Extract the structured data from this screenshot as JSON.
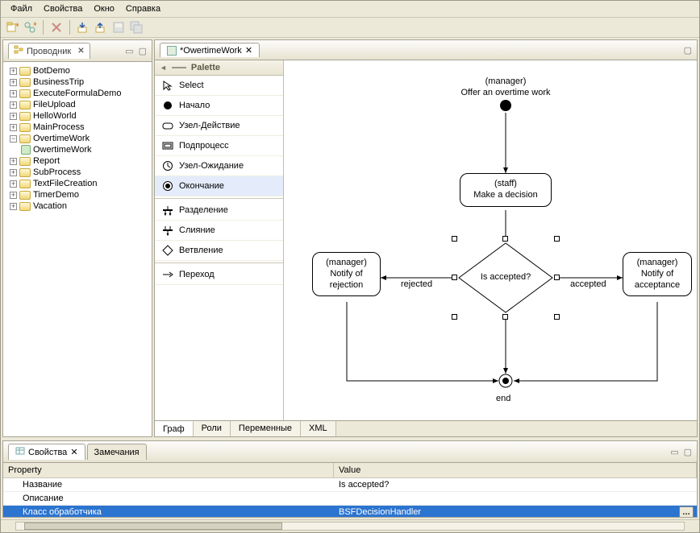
{
  "menu": {
    "file": "Файл",
    "properties": "Свойства",
    "window": "Окно",
    "help": "Справка"
  },
  "explorer": {
    "title": "Проводник",
    "items": [
      {
        "label": "BotDemo",
        "exp": "+"
      },
      {
        "label": "BusinessTrip",
        "exp": "+"
      },
      {
        "label": "ExecuteFormulaDemo",
        "exp": "+"
      },
      {
        "label": "FileUpload",
        "exp": "+"
      },
      {
        "label": "HelloWorld",
        "exp": "+"
      },
      {
        "label": "MainProcess",
        "exp": "+"
      },
      {
        "label": "OvertimeWork",
        "exp": "−",
        "children": [
          {
            "label": "OwertimeWork"
          }
        ]
      },
      {
        "label": "Report",
        "exp": "+"
      },
      {
        "label": "SubProcess",
        "exp": "+"
      },
      {
        "label": "TextFileCreation",
        "exp": "+"
      },
      {
        "label": "TimerDemo",
        "exp": "+"
      },
      {
        "label": "Vacation",
        "exp": "+"
      }
    ]
  },
  "editor": {
    "tab": "*OwertimeWork"
  },
  "palette": {
    "title": "Palette",
    "items": [
      {
        "label": "Select"
      },
      {
        "label": "Начало"
      },
      {
        "label": "Узел-Действие"
      },
      {
        "label": "Подпроцесс"
      },
      {
        "label": "Узел-Ожидание"
      },
      {
        "label": "Окончание"
      },
      {
        "label": "Разделение"
      },
      {
        "label": "Слияние"
      },
      {
        "label": "Ветвление"
      },
      {
        "label": "Переход"
      }
    ]
  },
  "diagram": {
    "start_role": "(manager)",
    "start_label": "Offer an overtime work",
    "decision_role": "(staff)",
    "decision_label": "Make a decision",
    "diamond_label": "Is accepted?",
    "left_role": "(manager)",
    "left_label1": "Notify of",
    "left_label2": "rejection",
    "right_role": "(manager)",
    "right_label1": "Notify of",
    "right_label2": "acceptance",
    "edge_rejected": "rejected",
    "edge_accepted": "accepted",
    "end_label": "end"
  },
  "bottom_editor_tabs": {
    "graph": "Граф",
    "roles": "Роли",
    "vars": "Переменные",
    "xml": "XML"
  },
  "properties": {
    "tab1": "Свойства",
    "tab2": "Замечания",
    "col_prop": "Property",
    "col_val": "Value",
    "rows": [
      {
        "p": "Название",
        "v": "Is accepted?"
      },
      {
        "p": "Описание",
        "v": ""
      },
      {
        "p": "Класс обработчика",
        "v": "BSFDecisionHandler"
      }
    ],
    "edit_btn": "…"
  }
}
